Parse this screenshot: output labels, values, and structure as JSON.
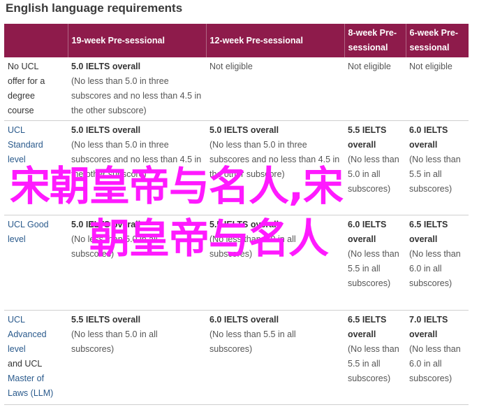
{
  "title": "English language requirements",
  "columns": [
    "",
    "19-week Pre-sessional",
    "12-week Pre-sessional",
    "8-week Pre-sessional",
    "6-week Pre-sessional"
  ],
  "rows": [
    {
      "level_lines": [
        "No UCL",
        "offer for a",
        "degree",
        "course"
      ],
      "cells": [
        {
          "score": "5.0 IELTS overall",
          "condition": "(No less than 5.0 in three subscores and no less than 4.5 in the other subscore)"
        },
        {
          "plain": "Not eligible"
        },
        {
          "plain": "Not eligible"
        },
        {
          "plain": "Not eligible"
        }
      ]
    },
    {
      "level_lines": [
        "UCL",
        "Standard",
        "level"
      ],
      "cells": [
        {
          "score": "5.0 IELTS overall",
          "condition": "(No less than 5.0 in three subscores and no less than 4.5 in the other subscore)"
        },
        {
          "score": "5.0 IELTS overall",
          "condition": "(No less than 5.0 in three subscores and no less than 4.5 in the other subscore)"
        },
        {
          "score": "5.5 IELTS overall",
          "condition": "(No less than 5.0 in all subscores)"
        },
        {
          "score": "6.0 IELTS overall",
          "condition": "(No less than 5.5 in all subscores)"
        }
      ]
    },
    {
      "level_lines": [
        "UCL Good",
        "level"
      ],
      "cells": [
        {
          "score": "5.0 IELTS overall",
          "condition": "(No less than 5.0 in all subscores)"
        },
        {
          "score": "5.5 IELTS overall",
          "condition": "(No less than 5.0 in all subscores)"
        },
        {
          "score": "6.0 IELTS overall",
          "condition": "(No less than 5.5 in all subscores)"
        },
        {
          "score": "6.5 IELTS overall",
          "condition": "(No less than 6.0 in all subscores)"
        }
      ]
    },
    {
      "level_lines": [
        "UCL",
        "Advanced",
        "level",
        "and UCL",
        "Master of",
        "Laws (LLM)"
      ],
      "cells": [
        {
          "score": "5.5 IELTS overall",
          "condition": "(No less than 5.0 in all subscores)"
        },
        {
          "score": "6.0 IELTS overall",
          "condition": "(No less than 5.5 in all subscores)"
        },
        {
          "score": "6.5 IELTS overall",
          "condition": "(No less than 5.5 in all subscores)"
        },
        {
          "score": "7.0 IELTS overall",
          "condition": "(No less than 6.0 in all subscores)"
        }
      ]
    }
  ],
  "watermark": {
    "line1": "宋朝皇帝与名人,宋",
    "line2": "朝皇帝与名人"
  },
  "colors": {
    "header_bg": "#8e1b4b",
    "header_text": "#ffffff",
    "link": "#2a5a8c",
    "watermark": "#ff1aff"
  }
}
